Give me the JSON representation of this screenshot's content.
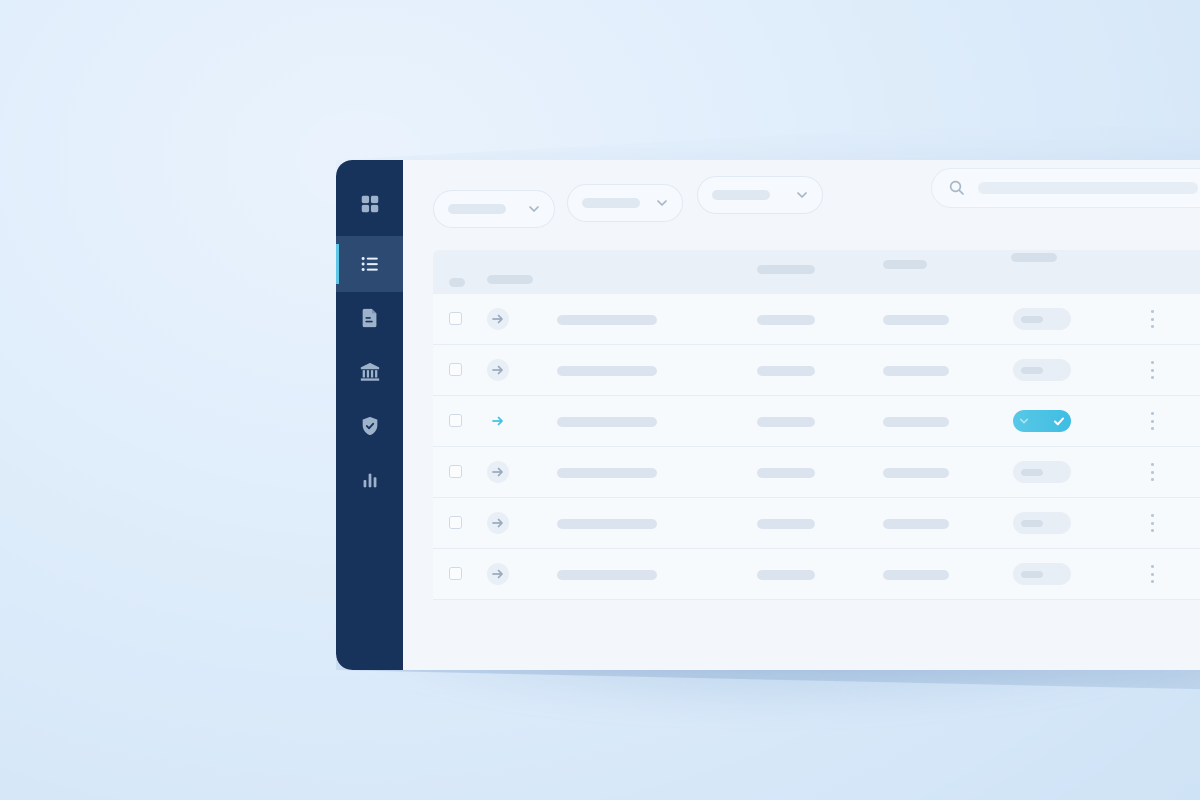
{
  "colors": {
    "sidebar": "#17335c",
    "sidebar_active": "#2d4a73",
    "accent": "#45c1e4",
    "panel": "#f3f7fc",
    "background": "#dcebfa"
  },
  "sidebar": {
    "items": [
      {
        "icon": "grid-icon",
        "active": false
      },
      {
        "icon": "list-icon",
        "active": true
      },
      {
        "icon": "document-icon",
        "active": false
      },
      {
        "icon": "bank-icon",
        "active": false
      },
      {
        "icon": "shield-check-icon",
        "active": false
      },
      {
        "icon": "bar-chart-icon",
        "active": false
      }
    ]
  },
  "toolbar": {
    "filters": [
      {
        "icon": "chevron-down-icon"
      },
      {
        "icon": "chevron-down-icon"
      },
      {
        "icon": "chevron-down-icon"
      }
    ],
    "search": {
      "icon": "search-icon"
    }
  },
  "table": {
    "row_count": 6,
    "rows": [
      {
        "highlighted": false,
        "status_on": false
      },
      {
        "highlighted": false,
        "status_on": false
      },
      {
        "highlighted": true,
        "status_on": true
      },
      {
        "highlighted": false,
        "status_on": false
      },
      {
        "highlighted": false,
        "status_on": false
      },
      {
        "highlighted": false,
        "status_on": false
      }
    ]
  }
}
